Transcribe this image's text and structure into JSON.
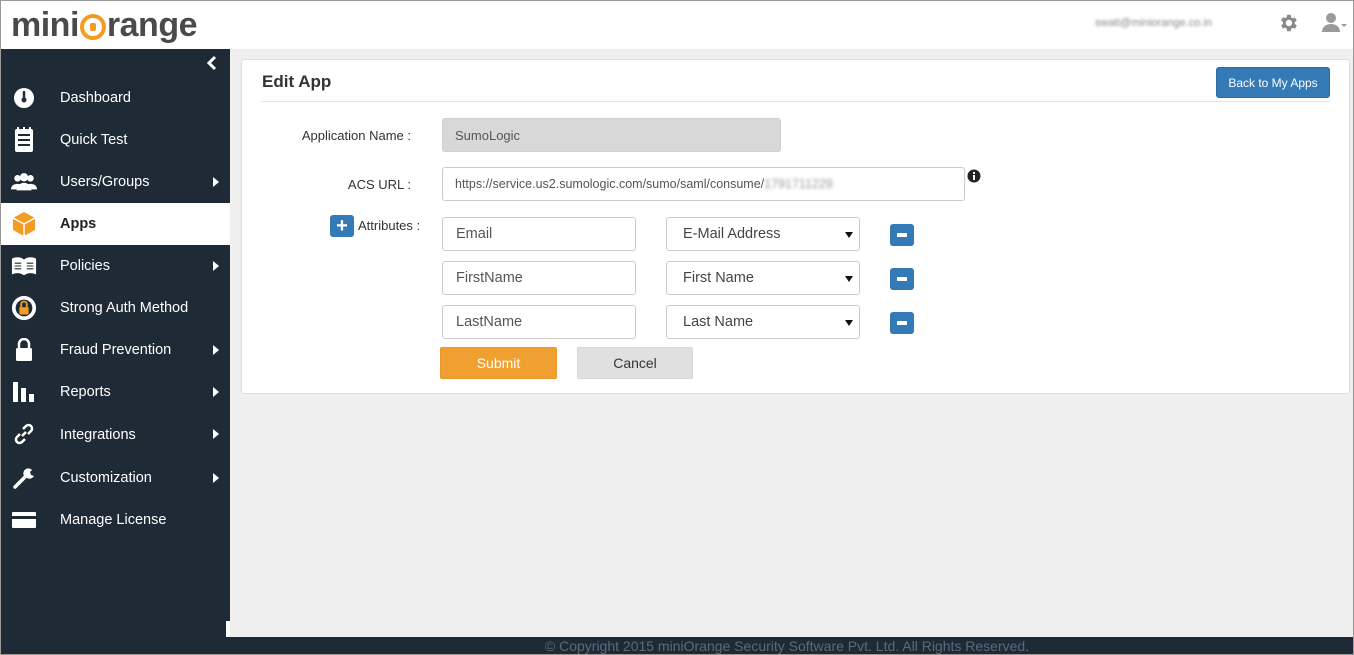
{
  "header": {
    "logo_text_left": "mini",
    "logo_text_right": "range",
    "user_email": "swati@miniorange.co.in"
  },
  "sidebar": {
    "items": [
      {
        "label": "Dashboard",
        "icon": "dashboard-icon",
        "has_submenu": false
      },
      {
        "label": "Quick Test",
        "icon": "quick-test-icon",
        "has_submenu": false
      },
      {
        "label": "Users/Groups",
        "icon": "users-icon",
        "has_submenu": true
      },
      {
        "label": "Apps",
        "icon": "apps-cube-icon",
        "has_submenu": false,
        "active": true
      },
      {
        "label": "Policies",
        "icon": "book-icon",
        "has_submenu": true
      },
      {
        "label": "Strong Auth Method",
        "icon": "strong-auth-icon",
        "has_submenu": false
      },
      {
        "label": "Fraud Prevention",
        "icon": "lock-icon",
        "has_submenu": true
      },
      {
        "label": "Reports",
        "icon": "bar-chart-icon",
        "has_submenu": true
      },
      {
        "label": "Integrations",
        "icon": "link-icon",
        "has_submenu": true
      },
      {
        "label": "Customization",
        "icon": "wrench-icon",
        "has_submenu": true
      },
      {
        "label": "Manage License",
        "icon": "card-icon",
        "has_submenu": false
      }
    ]
  },
  "panel": {
    "title": "Edit App",
    "back_button": "Back to My Apps",
    "app_name_label": "Application Name :",
    "app_name_value": "SumoLogic",
    "acs_label": "ACS URL :",
    "acs_value": "https://service.us2.sumologic.com/sumo/saml/consume/",
    "acs_value_hidden": "1791711229",
    "attributes_label": "Attributes :",
    "attributes": [
      {
        "name": "Email",
        "mapping": "E-Mail Address"
      },
      {
        "name": "FirstName",
        "mapping": "First Name"
      },
      {
        "name": "LastName",
        "mapping": "Last Name"
      }
    ],
    "submit_label": "Submit",
    "cancel_label": "Cancel"
  },
  "footer": {
    "copyright": "© Copyright 2015 miniOrange Security Software Pvt. Ltd. All Rights Reserved."
  },
  "colors": {
    "sidebar_bg": "#1e2b37",
    "accent_blue": "#337ab7",
    "brand_orange": "#f39c23",
    "submit_orange": "#f0a030"
  }
}
